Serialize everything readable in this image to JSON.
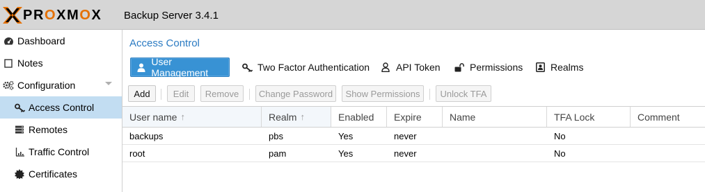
{
  "header": {
    "logo_prefix": "PR",
    "logo_o1": "O",
    "logo_mid": "XM",
    "logo_o2": "O",
    "logo_suffix": "X",
    "version": "Backup Server 3.4.1",
    "brand_color": "#e57000"
  },
  "sidebar": {
    "items": [
      {
        "label": "Dashboard",
        "icon": "dashboard-icon"
      },
      {
        "label": "Notes",
        "icon": "notes-icon"
      },
      {
        "label": "Configuration",
        "icon": "gears-icon"
      },
      {
        "label": "Access Control",
        "icon": "key-icon",
        "active": true
      },
      {
        "label": "Remotes",
        "icon": "server-icon"
      },
      {
        "label": "Traffic Control",
        "icon": "traffic-chart-icon"
      },
      {
        "label": "Certificates",
        "icon": "certificate-icon"
      }
    ]
  },
  "main": {
    "title": "Access Control",
    "tabs": [
      {
        "label": "User Management",
        "icon": "user-icon",
        "active": true
      },
      {
        "label": "Two Factor Authentication",
        "icon": "key-icon"
      },
      {
        "label": "API Token",
        "icon": "user-outline-icon"
      },
      {
        "label": "Permissions",
        "icon": "unlock-icon"
      },
      {
        "label": "Realms",
        "icon": "address-book-icon"
      }
    ],
    "toolbar": {
      "add": "Add",
      "edit": "Edit",
      "remove": "Remove",
      "change_password": "Change Password",
      "show_permissions": "Show Permissions",
      "unlock_tfa": "Unlock TFA"
    },
    "grid": {
      "columns": [
        "User name",
        "Realm",
        "Enabled",
        "Expire",
        "Name",
        "TFA Lock",
        "Comment"
      ],
      "sort_indicator": "↑",
      "rows": [
        [
          "backups",
          "pbs",
          "Yes",
          "never",
          "",
          "No",
          ""
        ],
        [
          "root",
          "pam",
          "Yes",
          "never",
          "",
          "No",
          ""
        ]
      ]
    },
    "accent_color": "#3892d4",
    "title_color": "#2a7ac2"
  }
}
